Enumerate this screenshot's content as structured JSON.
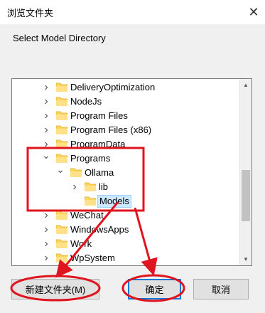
{
  "window": {
    "title": "浏览文件夹",
    "close_symbol": "✕"
  },
  "prompt": "Select Model Directory",
  "tree": {
    "rows": [
      {
        "label": "DeliveryOptimization",
        "level": 0,
        "expanded": false,
        "selected": false
      },
      {
        "label": "NodeJs",
        "level": 0,
        "expanded": false,
        "selected": false
      },
      {
        "label": "Program Files",
        "level": 0,
        "expanded": false,
        "selected": false
      },
      {
        "label": "Program Files (x86)",
        "level": 0,
        "expanded": false,
        "selected": false
      },
      {
        "label": "ProgramData",
        "level": 0,
        "expanded": false,
        "selected": false
      },
      {
        "label": "Programs",
        "level": 0,
        "expanded": true,
        "selected": false
      },
      {
        "label": "Ollama",
        "level": 1,
        "expanded": true,
        "selected": false
      },
      {
        "label": "lib",
        "level": 2,
        "expanded": false,
        "selected": false
      },
      {
        "label": "Models",
        "level": 2,
        "leaf": true,
        "selected": true
      },
      {
        "label": "WeChat",
        "level": 0,
        "expanded": false,
        "selected": false
      },
      {
        "label": "WindowsApps",
        "level": 0,
        "expanded": false,
        "selected": false
      },
      {
        "label": "Work",
        "level": 0,
        "expanded": false,
        "selected": false
      },
      {
        "label": "WpSystem",
        "level": 0,
        "expanded": false,
        "selected": false
      }
    ]
  },
  "buttons": {
    "new_folder": "新建文件夹(M)",
    "ok": "确定",
    "cancel": "取消"
  },
  "colors": {
    "annotation": "#e0141e",
    "selection": "#cce8ff",
    "folder": "#ffd65a"
  }
}
